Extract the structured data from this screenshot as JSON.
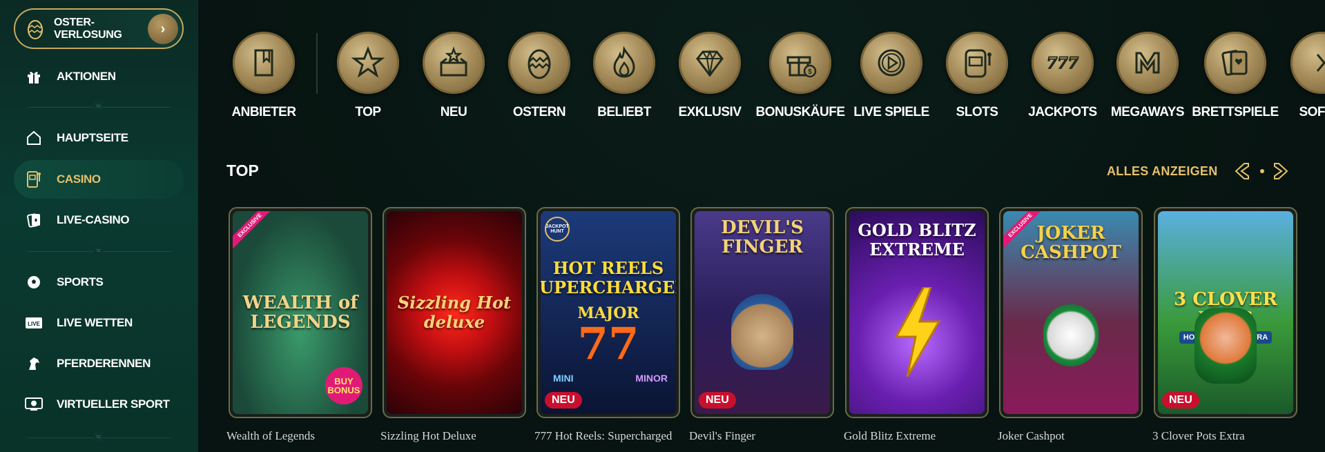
{
  "sidebar": {
    "promo": {
      "label": "OSTER-\nVERLOSUNG",
      "icon": "easter-egg-icon",
      "arrow_icon": "chevron-right-icon"
    },
    "items": [
      {
        "label": "AKTIONEN",
        "icon": "gift-icon"
      },
      {
        "label": "HAUPTSEITE",
        "icon": "home-icon"
      },
      {
        "label": "CASINO",
        "icon": "slot-machine-icon",
        "active": true
      },
      {
        "label": "LIVE-CASINO",
        "icon": "playing-cards-icon"
      },
      {
        "label": "SPORTS",
        "icon": "soccer-ball-icon"
      },
      {
        "label": "LIVE WETTEN",
        "icon": "live-icon"
      },
      {
        "label": "PFERDERENNEN",
        "icon": "horse-icon"
      },
      {
        "label": "VIRTUELLER SPORT",
        "icon": "virtual-sport-icon"
      }
    ]
  },
  "categories": [
    {
      "label": "ANBIETER",
      "icon": "book-icon"
    },
    {
      "label": "TOP",
      "icon": "star-icon"
    },
    {
      "label": "NEU",
      "icon": "box-star-icon"
    },
    {
      "label": "OSTERN",
      "icon": "easter-egg-icon"
    },
    {
      "label": "BELIEBT",
      "icon": "flame-icon"
    },
    {
      "label": "EXKLUSIV",
      "icon": "diamond-icon"
    },
    {
      "label": "BONUSKÄUFE",
      "icon": "gift-coin-icon"
    },
    {
      "label": "LIVE SPIELE",
      "icon": "play-icon"
    },
    {
      "label": "SLOTS",
      "icon": "slot-machine-icon"
    },
    {
      "label": "JACKPOTS",
      "icon": "777-icon"
    },
    {
      "label": "MEGAWAYS",
      "icon": "megaways-icon"
    },
    {
      "label": "BRETTSPIELE",
      "icon": "card-suits-icon"
    },
    {
      "label": "SOFOR",
      "icon": "sofort-icon"
    }
  ],
  "section": {
    "title": "TOP",
    "view_all": "ALLES ANZEIGEN",
    "prev_icon": "arrow-left-icon",
    "next_icon": "arrow-right-icon"
  },
  "games": [
    {
      "name": "Wealth of Legends",
      "art_title": "WEALTH of LEGENDS",
      "badge": "EXCLUSIVE",
      "extra": "BUY BONUS",
      "colors": [
        "#2f7f5a",
        "#1b4a3a"
      ]
    },
    {
      "name": "Sizzling Hot Deluxe",
      "art_title": "Sizzling Hot deluxe",
      "colors": [
        "#8b0b12",
        "#2a0207"
      ]
    },
    {
      "name": "777 Hot Reels: Supercharged",
      "art_title": "HOT REELS SUPERCHARGED",
      "top_label": "JACKPOT HUNT",
      "mid_label": "MAJOR",
      "labels": [
        "MINI",
        "MINOR"
      ],
      "badge_new": "NEU",
      "colors": [
        "#142a5a",
        "#0b1433"
      ]
    },
    {
      "name": "Devil's Finger",
      "art_title": "DEVIL'S FINGER",
      "badge_new": "NEU",
      "colors": [
        "#3b2b6a",
        "#1f1638"
      ]
    },
    {
      "name": "Gold Blitz Extreme",
      "art_title": "GOLD BLITZ EXTREME",
      "colors": [
        "#6a1fb0",
        "#2b0c5a"
      ]
    },
    {
      "name": "Joker Cashpot",
      "art_title": "JOKER CASHPOT",
      "badge": "EXCLUSIVE",
      "colors": [
        "#2a6a8a",
        "#5a1a3a"
      ]
    },
    {
      "name": "3 Clover Pots Extra",
      "art_title": "3 CLOVER POTS",
      "subtitle": "HOLD AND WIN EXTRA",
      "badge_new": "NEU",
      "colors": [
        "#3a9a3a",
        "#1a5a2a"
      ]
    }
  ]
}
